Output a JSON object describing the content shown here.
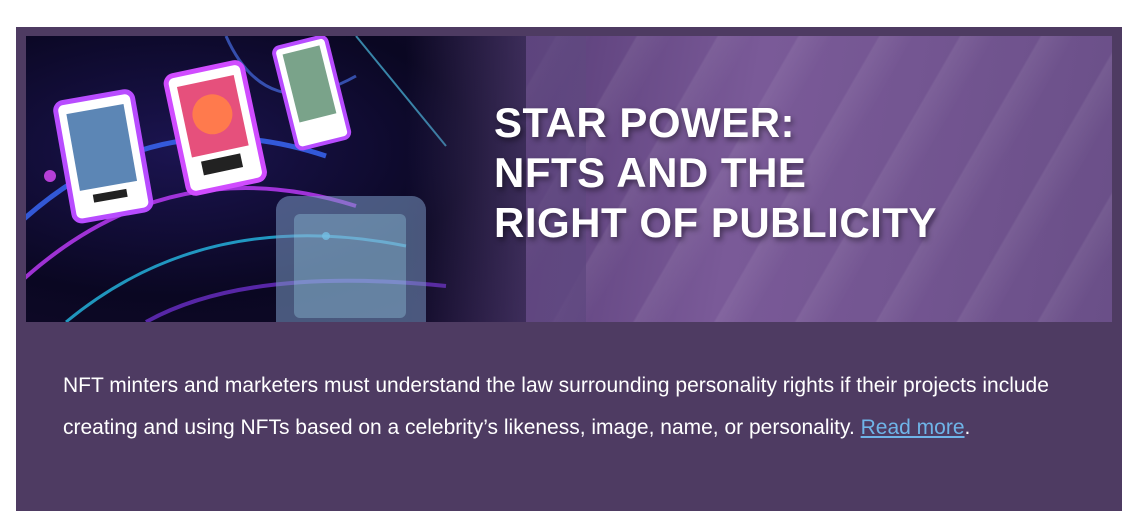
{
  "banner": {
    "title_lines": [
      "STAR POWER:",
      "NFTS AND THE",
      "RIGHT OF PUBLICITY"
    ]
  },
  "article": {
    "description": "NFT minters and marketers must understand the law surrounding personality rights if their projects include creating and using NFTs based on a celebrity’s likeness, image, name, or personality. ",
    "read_more_label": "Read more",
    "trailing_punct": "."
  },
  "colors": {
    "card_background": "#4e3b62",
    "link": "#6fb4e8",
    "title_text": "#ffffff"
  }
}
